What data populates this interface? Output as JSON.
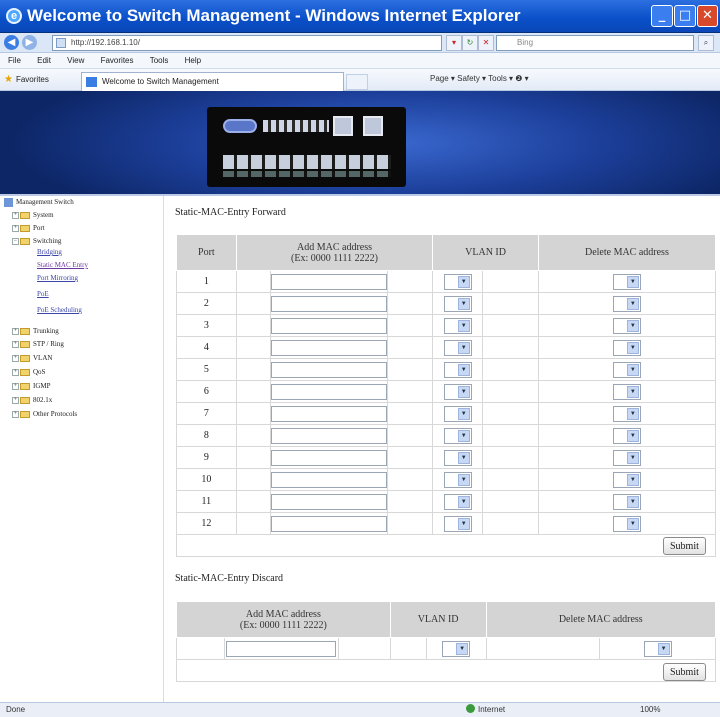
{
  "window": {
    "title": "Welcome to Switch Management - Windows Internet Explorer",
    "min": "_",
    "max": "□",
    "close": "✕"
  },
  "addressbar": {
    "url": "http://192.168.1.10/",
    "search_placeholder": "Bing",
    "back": "◀",
    "forward": "▶"
  },
  "menu": {
    "items": [
      "File",
      "Edit",
      "View",
      "Favorites",
      "Tools",
      "Help"
    ]
  },
  "favorites": {
    "label": "Favorites",
    "tab": "Welcome to Switch Management",
    "tools": "Page ▾  Safety ▾  Tools ▾  ❷ ▾"
  },
  "sidebar": {
    "root": "Management Switch",
    "nodes": [
      "System",
      "Port",
      "Switching",
      "Trunking",
      "STP / Ring",
      "VLAN",
      "QoS",
      "IGMP",
      "802.1x",
      "Other Protocols"
    ],
    "switching_children": [
      "Bridging",
      "Static MAC Entry",
      "Port Mirroring",
      "PoE",
      "PoE Scheduling"
    ]
  },
  "forward": {
    "title": "Static-MAC-Entry Forward",
    "headers": {
      "port": "Port",
      "add_mac": "Add MAC address",
      "add_mac_hint": "(Ex: 0000 1111 2222)",
      "vlan": "VLAN ID",
      "delete": "Delete MAC address"
    },
    "ports": [
      "1",
      "2",
      "3",
      "4",
      "5",
      "6",
      "7",
      "8",
      "9",
      "10",
      "11",
      "12"
    ],
    "submit": "Submit"
  },
  "discard": {
    "title": "Static-MAC-Entry Discard",
    "headers": {
      "add_mac": "Add MAC address",
      "add_mac_hint": "(Ex: 0000 1111 2222)",
      "vlan": "VLAN ID",
      "delete": "Delete MAC address"
    },
    "submit": "Submit"
  },
  "status": {
    "left": "Done",
    "zone": "Internet",
    "zoom": "100%"
  }
}
